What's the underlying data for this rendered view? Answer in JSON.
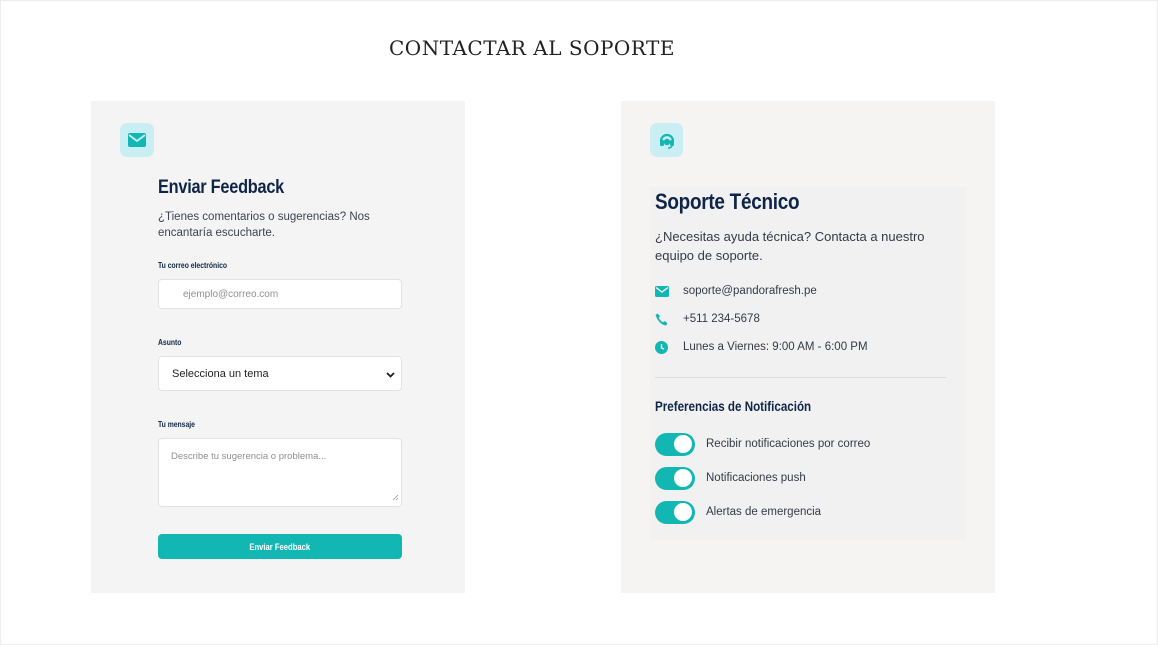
{
  "page": {
    "title": "CONTACTAR AL SOPORTE"
  },
  "feedback": {
    "icon": "envelope-icon",
    "title": "Enviar Feedback",
    "description": "¿Tienes comentarios o sugerencias? Nos encantaría escucharte.",
    "email_label": "Tu correo electrónico",
    "email_placeholder": "ejemplo@correo.com",
    "subject_label": "Asunto",
    "subject_selected": "Selecciona un tema",
    "message_label": "Tu mensaje",
    "message_placeholder": "Describe tu sugerencia o problema...",
    "submit_label": "Enviar Feedback"
  },
  "support": {
    "icon": "headset-icon",
    "title": "Soporte Técnico",
    "description": "¿Necesitas ayuda técnica? Contacta a nuestro equipo de soporte.",
    "contacts": [
      {
        "icon": "envelope-icon",
        "text": "soporte@pandorafresh.pe"
      },
      {
        "icon": "phone-icon",
        "text": "+511 234-5678"
      },
      {
        "icon": "clock-icon",
        "text": "Lunes a Viernes: 9:00 AM - 6:00 PM"
      }
    ],
    "notifications_title": "Preferencias de Notificación",
    "toggles": [
      {
        "label": "Recibir notificaciones por correo",
        "on": true
      },
      {
        "label": "Notificaciones push",
        "on": true
      },
      {
        "label": "Alertas de emergencia",
        "on": true
      }
    ]
  },
  "colors": {
    "accent": "#12b7b4",
    "heading": "#0f2547",
    "icon_bg": "#c9eef3"
  }
}
